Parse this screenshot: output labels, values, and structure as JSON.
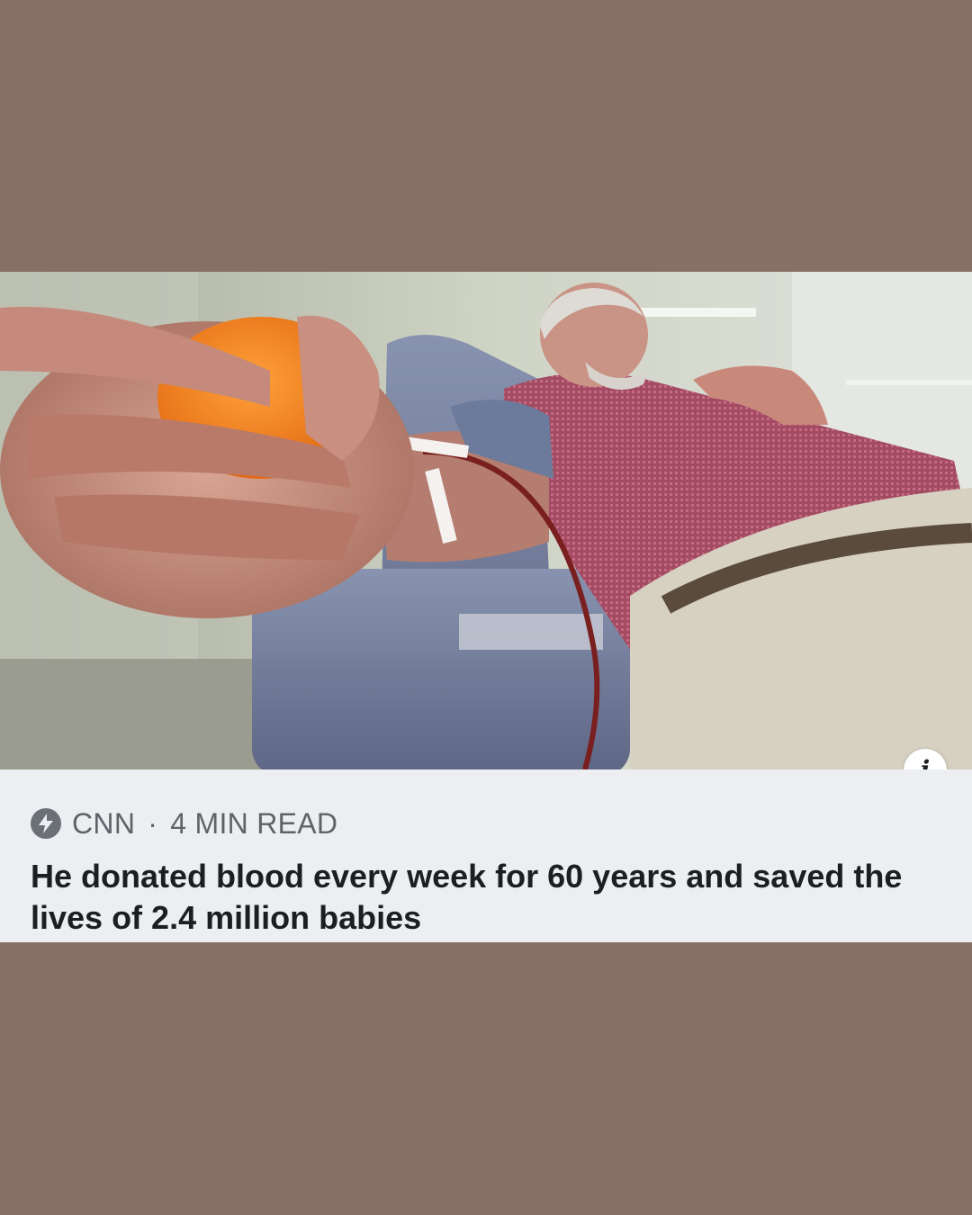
{
  "card": {
    "source": "CNN",
    "separator": "·",
    "read_time": "4 MIN READ",
    "headline": "He donated blood every week for 60 years and saved the lives of 2.4 million babies",
    "info_label": "i",
    "source_icon": "lightning-bolt-icon"
  },
  "colors": {
    "background": "#876f66",
    "caption_bg": "#eceef1",
    "headline_text": "#1c1e21",
    "meta_text": "#5f6368"
  }
}
